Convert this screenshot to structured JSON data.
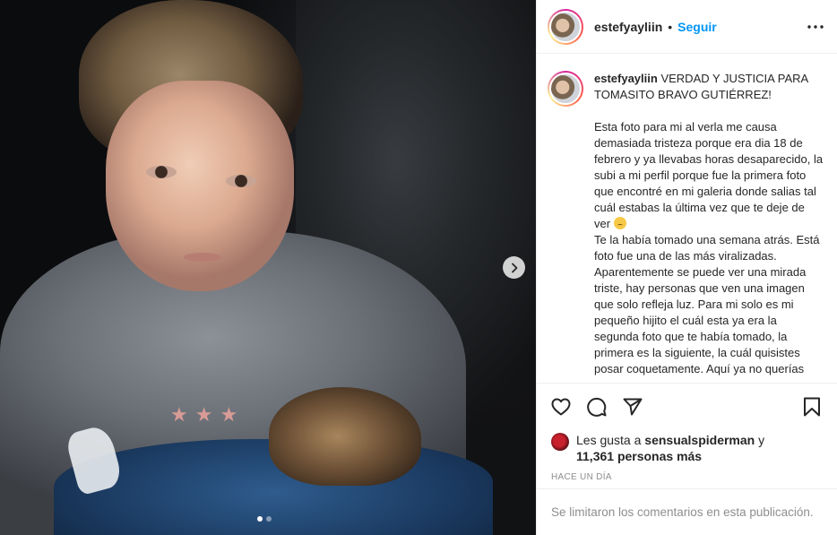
{
  "post": {
    "username": "estefyayliin",
    "separator": "•",
    "follow_label": "Seguir",
    "more_icon": "more-horizontal-icon",
    "caption": {
      "username": "estefyayliin",
      "headline": "VERDAD Y JUSTICIA PARA TOMASITO BRAVO GUTIÉRREZ!",
      "para1": "Esta foto para mi al verla me causa demasiada tristeza porque era dia 18 de febrero y ya llevabas horas desaparecido, la subi a mi perfil porque fue la primera foto que encontré en mi galeria donde salias tal cuál estabas la última vez que te deje de ver",
      "emoji": "disappointed-face-emoji",
      "para2": "Te la había tomado una semana atrás. Está foto fue una de las más viralizadas. Aparentemente se puede ver una mirada triste, hay personas que ven una imagen que solo refleja luz. Para mi solo es mi pequeño hijito el cuál esta ya era la segunda foto que te había tomado, la primera es la siguiente, la cuál quisistes posar coquetamente. Aquí ya no querías"
    },
    "likes": {
      "prefix": "Les gusta a",
      "user": "sensualspiderman",
      "suffix": "y",
      "others": "11,361 personas más"
    },
    "time_ago": "HACE UN DÍA",
    "comments_disabled": "Se limitaron los comentarios en esta publicación."
  },
  "carousel": {
    "current": 1,
    "total": 2
  },
  "colors": {
    "accent": "#0095f6",
    "muted": "#8e8e8e",
    "text": "#262626",
    "border": "#efefef"
  }
}
